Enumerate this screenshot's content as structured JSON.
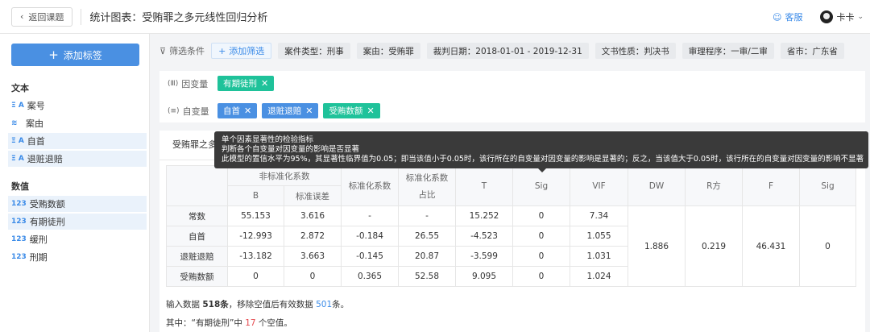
{
  "header": {
    "back_label": "返回课题",
    "title": "统计图表：受贿罪之多元线性回归分析",
    "service_label": "客服",
    "user_name": "卡卡"
  },
  "sidebar": {
    "add_tag_label": "添加标签",
    "text_section": "文本",
    "text_items": [
      {
        "icon": "Ξ A",
        "label": "案号"
      },
      {
        "icon": "≋",
        "label": "案由"
      },
      {
        "icon": "Ξ A",
        "label": "自首"
      },
      {
        "icon": "Ξ A",
        "label": "退赃退赔"
      }
    ],
    "number_section": "数值",
    "number_items": [
      {
        "icon": "123",
        "label": "受贿数额"
      },
      {
        "icon": "123",
        "label": "有期徒刑"
      },
      {
        "icon": "123",
        "label": "缓刑"
      },
      {
        "icon": "123",
        "label": "刑期"
      }
    ]
  },
  "filters": {
    "label": "筛选条件",
    "add_label": "添加筛选",
    "chips": [
      "案件类型：刑事",
      "案由：受贿罪",
      "裁判日期：2018-01-01 - 2019-12-31",
      "文书性质：判决书",
      "审理程序：一审/二审",
      "省市：广东省"
    ]
  },
  "variables": {
    "dependent_label": "因变量",
    "dependent": [
      "有期徒刑"
    ],
    "independent_label": "自变量",
    "independent": [
      "自首",
      "退赃退赔",
      "受贿数额"
    ]
  },
  "panel": {
    "tab_title": "受贿罪之多元线性回归分析"
  },
  "tooltip": {
    "line1": "单个因素显著性的检验指标",
    "line2": "判断各个自变量对因变量的影响是否显著",
    "line3": "此模型的置信水平为95%，其显著性临界值为0.05；即当该值小于0.05时，该行所在的自变量对因变量的影响是显著的；反之，当该值大于0.05时，该行所在的自变量对因变量的影响不显著"
  },
  "table": {
    "header_unstd": "非标准化系数",
    "header_b": "B",
    "header_se": "标准误差",
    "header_std": "标准化系数",
    "header_ratio_line1": "标准化系数",
    "header_ratio_line2": "占比",
    "header_t": "T",
    "header_sig": "Sig",
    "header_vif": "VIF",
    "header_dw": "DW",
    "header_r2": "R方",
    "header_f": "F",
    "header_sig2": "Sig",
    "rows": [
      {
        "label": "常数",
        "b": "55.153",
        "se": "3.616",
        "std": "-",
        "ratio": "-",
        "t": "15.252",
        "sig": "0",
        "vif": "7.34"
      },
      {
        "label": "自首",
        "b": "-12.993",
        "se": "2.872",
        "std": "-0.184",
        "ratio": "26.55",
        "t": "-4.523",
        "sig": "0",
        "vif": "1.055"
      },
      {
        "label": "退赃退赔",
        "b": "-13.182",
        "se": "3.663",
        "std": "-0.145",
        "ratio": "20.87",
        "t": "-3.599",
        "sig": "0",
        "vif": "1.031"
      },
      {
        "label": "受贿数额",
        "b": "0",
        "se": "0",
        "std": "0.365",
        "ratio": "52.58",
        "t": "9.095",
        "sig": "0",
        "vif": "1.024"
      }
    ],
    "model": {
      "dw": "1.886",
      "r2": "0.219",
      "f": "46.431",
      "sig": "0"
    }
  },
  "summary": {
    "line1_prefix": "输入数据 ",
    "line1_total": "518条",
    "line1_mid": "，移除空值后有效数据 ",
    "line1_valid": "501",
    "line1_suffix": "条。",
    "line2_prefix": "其中：“有期徒刑”中 ",
    "line2_count": "17",
    "line2_suffix": " 个空值。"
  },
  "colors": {
    "accent": "#4a90e2",
    "green_tag": "#1fc29a",
    "tooltip_bg": "#3a3a3a",
    "highlight_red": "#e5484d"
  }
}
